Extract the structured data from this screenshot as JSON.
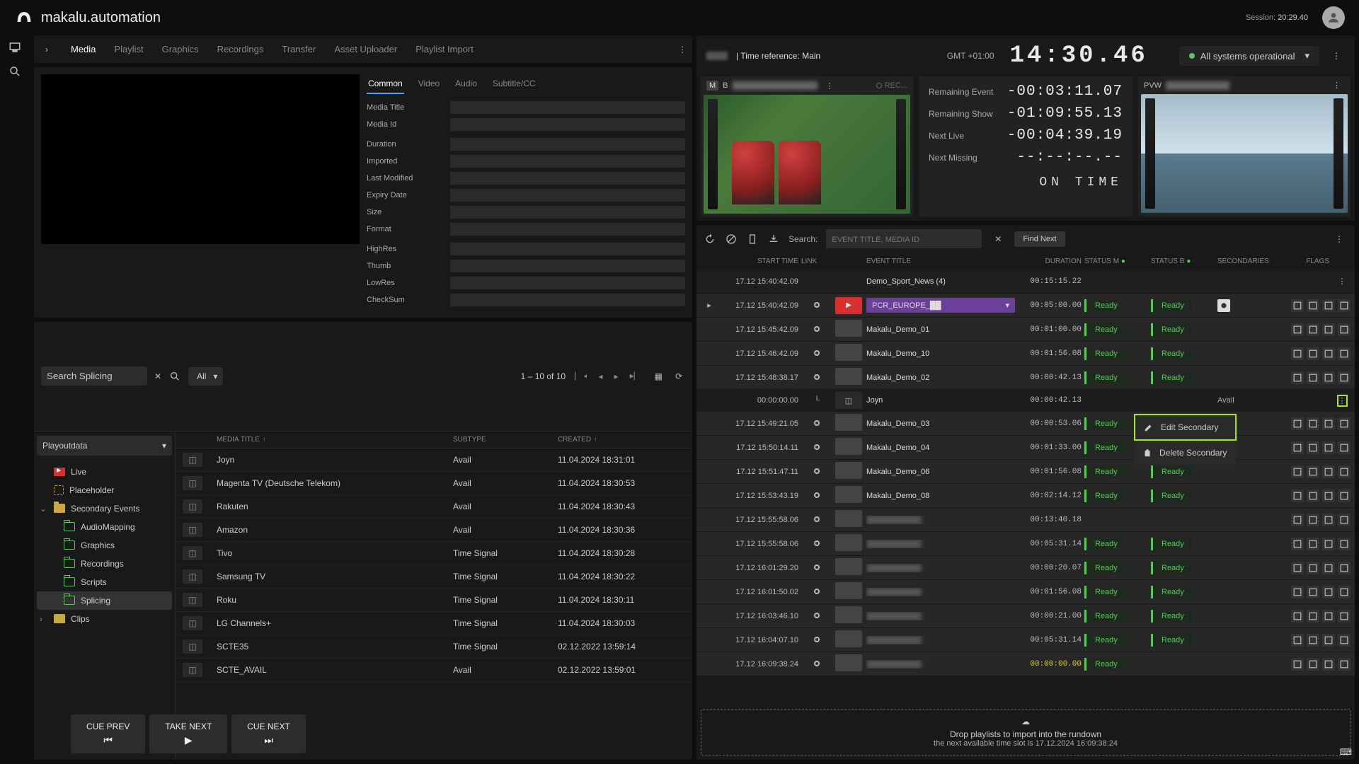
{
  "app": {
    "title": "makalu.automation"
  },
  "session": {
    "label": "Session:",
    "time": "20:29.40"
  },
  "topbar": {
    "time_ref": "| Time reference: Main",
    "gmt": "GMT +01:00",
    "clock": "14:30.46",
    "sys_status": "All systems operational"
  },
  "monitors": {
    "left": {
      "badge": "M",
      "label": "B",
      "title_blur": "████",
      "rec": "REC..."
    },
    "right": {
      "pvw": "PVW",
      "title_blur": "████"
    }
  },
  "timers": {
    "remaining_event": {
      "label": "Remaining Event",
      "value": "-00:03:11.07"
    },
    "remaining_show": {
      "label": "Remaining Show",
      "value": "-01:09:55.13"
    },
    "next_live": {
      "label": "Next Live",
      "value": "-00:04:39.19"
    },
    "next_missing": {
      "label": "Next Missing",
      "value": "--:--:--.--"
    },
    "ontime": "ON TIME"
  },
  "rundown_toolbar": {
    "search_label": "Search:",
    "search_placeholder": "EVENT TITLE, MEDIA ID",
    "find_next": "Find Next"
  },
  "rundown_columns": {
    "start": "START TIME",
    "link": "LINK",
    "event_title": "EVENT TITLE",
    "duration": "DURATION",
    "status_m": "STATUS M",
    "status_b": "STATUS B",
    "secondaries": "SECONDARIES",
    "flags": "FLAGS"
  },
  "rundown": [
    {
      "type": "head",
      "date": "17.12",
      "start": "15:40:42.09",
      "title": "Demo_Sport_News (4)",
      "duration": "00:15:15.22"
    },
    {
      "type": "current",
      "date": "17.12",
      "start": "15:40:42.09",
      "title": "PCR_EUROPE_██",
      "duration": "00:05:00.00",
      "m": "Ready",
      "b": "Ready",
      "camIcon": true
    },
    {
      "type": "row",
      "date": "17.12",
      "start": "15:45:42.09",
      "title": "Makalu_Demo_01",
      "duration": "00:01:00.00",
      "m": "Ready",
      "b": "Ready"
    },
    {
      "type": "row",
      "date": "17.12",
      "start": "15:46:42.09",
      "title": "Makalu_Demo_10",
      "duration": "00:01:56.08",
      "m": "Ready",
      "b": "Ready"
    },
    {
      "type": "row",
      "date": "17.12",
      "start": "15:48:38.17",
      "title": "Makalu_Demo_02",
      "duration": "00:00:42.13",
      "m": "Ready",
      "b": "Ready"
    },
    {
      "type": "sec",
      "start": "00:00:00.00",
      "title": "Joyn",
      "duration": "00:00:42.13",
      "secondary": "Avail",
      "highlightMore": true
    },
    {
      "type": "row",
      "date": "17.12",
      "start": "15:49:21.05",
      "title": "Makalu_Demo_03",
      "duration": "00:00:53.06",
      "m": "Ready",
      "b": "Ready"
    },
    {
      "type": "row",
      "date": "17.12",
      "start": "15:50:14.11",
      "title": "Makalu_Demo_04",
      "duration": "00:01:33.00",
      "m": "Ready",
      "b": "Ready"
    },
    {
      "type": "row",
      "date": "17.12",
      "start": "15:51:47.11",
      "title": "Makalu_Demo_06",
      "duration": "00:01:56.08",
      "m": "Ready",
      "b": "Ready"
    },
    {
      "type": "row",
      "date": "17.12",
      "start": "15:53:43.19",
      "title": "Makalu_Demo_08",
      "duration": "00:02:14.12",
      "m": "Ready",
      "b": "Ready"
    },
    {
      "type": "row",
      "date": "17.12",
      "start": "15:55:58.06",
      "title": "██████████",
      "duration": "00:13:40.18",
      "blur": true
    },
    {
      "type": "row",
      "date": "17.12",
      "start": "15:55:58.06",
      "title": "██████████",
      "duration": "00:05:31.14",
      "m": "Ready",
      "b": "Ready",
      "blur": true
    },
    {
      "type": "row",
      "date": "17.12",
      "start": "16:01:29.20",
      "title": "██████████",
      "duration": "00:00:20.07",
      "m": "Ready",
      "b": "Ready",
      "blur": true
    },
    {
      "type": "row",
      "date": "17.12",
      "start": "16:01:50.02",
      "title": "██████████",
      "duration": "00:01:56.08",
      "m": "Ready",
      "b": "Ready",
      "blur": true
    },
    {
      "type": "row",
      "date": "17.12",
      "start": "16:03:46.10",
      "title": "██████████",
      "duration": "00:00:21.00",
      "m": "Ready",
      "b": "Ready",
      "blur": true
    },
    {
      "type": "row",
      "date": "17.12",
      "start": "16:04:07.10",
      "title": "██████████",
      "duration": "00:05:31.14",
      "m": "Ready",
      "b": "Ready",
      "blur": true
    },
    {
      "type": "row",
      "date": "17.12",
      "start": "16:09:38.24",
      "title": "██████████",
      "duration": "00:00:00.00",
      "m": "Ready",
      "yellow": true,
      "blur": true
    }
  ],
  "ctx_menu": {
    "edit": "Edit Secondary",
    "delete": "Delete Secondary"
  },
  "drop": {
    "line1": "Drop playlists to import into the rundown",
    "line2": "the next available time slot is 17.12.2024 16:09:38.24"
  },
  "transport": {
    "cue_prev": "CUE PREV",
    "take_next": "TAKE NEXT",
    "cue_next": "CUE NEXT"
  },
  "right_tabs": [
    "Media",
    "Playlist",
    "Graphics",
    "Recordings",
    "Transfer",
    "Asset Uploader",
    "Playlist Import"
  ],
  "meta_tabs": [
    "Common",
    "Video",
    "Audio",
    "Subtitle/CC"
  ],
  "meta_fields": [
    "Media Title",
    "Media Id",
    "Duration",
    "Imported",
    "Last Modified",
    "Expiry Date",
    "Size",
    "Format",
    "HighRes",
    "Thumb",
    "LowRes",
    "CheckSum"
  ],
  "browser": {
    "search_value": "Search Splicing",
    "filter": "All",
    "pagination": "1 – 10 of 10",
    "root": "Playoutdata",
    "tree": [
      {
        "icon": "live",
        "label": "Live"
      },
      {
        "icon": "placeholder",
        "label": "Placeholder"
      },
      {
        "icon": "folder-open",
        "label": "Secondary Events",
        "expanded": true,
        "caret": "down",
        "children": [
          {
            "icon": "folder-out",
            "label": "AudioMapping"
          },
          {
            "icon": "folder-out",
            "label": "Graphics"
          },
          {
            "icon": "folder-out",
            "label": "Recordings"
          },
          {
            "icon": "folder-out",
            "label": "Scripts"
          },
          {
            "icon": "folder-out",
            "label": "Splicing",
            "selected": true
          }
        ]
      },
      {
        "icon": "folder",
        "label": "Clips",
        "caret": "right"
      }
    ],
    "columns": {
      "title": "MEDIA TITLE",
      "subtype": "SUBTYPE",
      "created": "CREATED"
    },
    "items": [
      {
        "title": "Joyn",
        "subtype": "Avail",
        "created": "11.04.2024 18:31:01"
      },
      {
        "title": "Magenta TV (Deutsche Telekom)",
        "subtype": "Avail",
        "created": "11.04.2024 18:30:53"
      },
      {
        "title": "Rakuten",
        "subtype": "Avail",
        "created": "11.04.2024 18:30:43"
      },
      {
        "title": "Amazon",
        "subtype": "Avail",
        "created": "11.04.2024 18:30:36"
      },
      {
        "title": "Tivo",
        "subtype": "Time Signal",
        "created": "11.04.2024 18:30:28"
      },
      {
        "title": "Samsung TV",
        "subtype": "Time Signal",
        "created": "11.04.2024 18:30:22"
      },
      {
        "title": "Roku",
        "subtype": "Time Signal",
        "created": "11.04.2024 18:30:11"
      },
      {
        "title": "LG Channels+",
        "subtype": "Time Signal",
        "created": "11.04.2024 18:30:03"
      },
      {
        "title": "SCTE35",
        "subtype": "Time Signal",
        "created": "02.12.2022 13:59:14"
      },
      {
        "title": "SCTE_AVAIL",
        "subtype": "Avail",
        "created": "02.12.2022 13:59:01"
      }
    ]
  }
}
